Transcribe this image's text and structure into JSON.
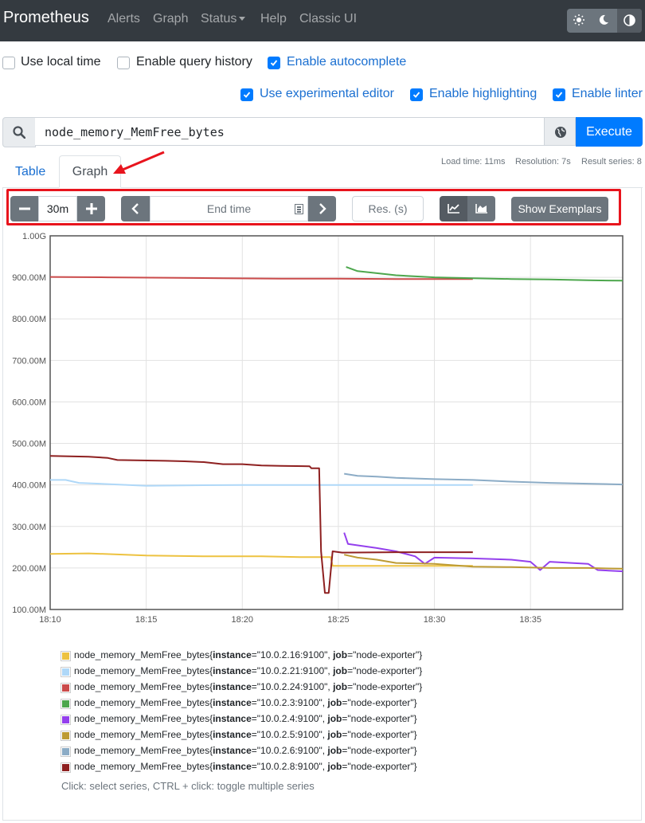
{
  "navbar": {
    "brand": "Prometheus",
    "links": [
      "Alerts",
      "Graph",
      "Status",
      "Help",
      "Classic UI"
    ],
    "theme_icons": [
      "sun-icon",
      "moon-icon",
      "contrast-icon"
    ]
  },
  "options_row1": [
    {
      "label": "Use local time",
      "checked": false
    },
    {
      "label": "Enable query history",
      "checked": false
    },
    {
      "label": "Enable autocomplete",
      "checked": true
    }
  ],
  "options_row2": [
    {
      "label": "Use experimental editor",
      "checked": true
    },
    {
      "label": "Enable highlighting",
      "checked": true
    },
    {
      "label": "Enable linter",
      "checked": true
    }
  ],
  "search": {
    "expression": "node_memory_MemFree_bytes",
    "execute_label": "Execute"
  },
  "tabs": {
    "table": "Table",
    "graph": "Graph"
  },
  "stats": {
    "load_time": "Load time: 11ms",
    "resolution": "Resolution: 7s",
    "result_series": "Result series: 8"
  },
  "controls": {
    "range": "30m",
    "end_time_placeholder": "End time",
    "resolution_placeholder": "Res. (s)",
    "show_exemplars": "Show Exemplars"
  },
  "chart_data": {
    "type": "line",
    "ylim": [
      100,
      1000
    ],
    "y_unit": "M",
    "yticks": [
      "1.00G",
      "900.00M",
      "800.00M",
      "700.00M",
      "600.00M",
      "500.00M",
      "400.00M",
      "300.00M",
      "200.00M",
      "100.00M"
    ],
    "xticks": [
      "18:10",
      "18:15",
      "18:20",
      "18:25",
      "18:30",
      "18:35"
    ],
    "xlim_minutes": [
      0,
      29.8
    ],
    "series": [
      {
        "metric": "node_memory_MemFree_bytes",
        "instance": "10.0.2.16:9100",
        "job": "node-exporter",
        "color": "#edc240",
        "points": [
          [
            0,
            234
          ],
          [
            2,
            235
          ],
          [
            5,
            230
          ],
          [
            8,
            228
          ],
          [
            11,
            228
          ],
          [
            13,
            226
          ],
          [
            14.6,
            226
          ],
          [
            14.7,
            205
          ],
          [
            20,
            205
          ],
          [
            22,
            205
          ]
        ]
      },
      {
        "metric": "node_memory_MemFree_bytes",
        "instance": "10.0.2.21:9100",
        "job": "node-exporter",
        "color": "#afd8f8",
        "points": [
          [
            0,
            412
          ],
          [
            0.8,
            412
          ],
          [
            1.5,
            405
          ],
          [
            3,
            402
          ],
          [
            5,
            398
          ],
          [
            7,
            399
          ],
          [
            10,
            400
          ],
          [
            14,
            400
          ],
          [
            18,
            400
          ],
          [
            21,
            400
          ],
          [
            22,
            400
          ]
        ]
      },
      {
        "metric": "node_memory_MemFree_bytes",
        "instance": "10.0.2.24:9100",
        "job": "node-exporter",
        "color": "#cb4b4b",
        "points": [
          [
            0,
            901
          ],
          [
            3,
            900
          ],
          [
            6,
            899
          ],
          [
            9,
            898
          ],
          [
            12,
            897
          ],
          [
            15,
            897
          ],
          [
            18,
            896
          ],
          [
            22,
            896
          ]
        ]
      },
      {
        "metric": "node_memory_MemFree_bytes",
        "instance": "10.0.2.3:9100",
        "job": "node-exporter",
        "color": "#4da74d",
        "points": [
          [
            15.4,
            925
          ],
          [
            16,
            915
          ],
          [
            17,
            910
          ],
          [
            18,
            905
          ],
          [
            20,
            900
          ],
          [
            22,
            898
          ],
          [
            24,
            896
          ],
          [
            26,
            895
          ],
          [
            28,
            893
          ],
          [
            29.8,
            892
          ]
        ]
      },
      {
        "metric": "node_memory_MemFree_bytes",
        "instance": "10.0.2.4:9100",
        "job": "node-exporter",
        "color": "#9440ed",
        "points": [
          [
            15.3,
            285
          ],
          [
            15.5,
            258
          ],
          [
            17,
            248
          ],
          [
            18,
            240
          ],
          [
            19,
            228
          ],
          [
            19.5,
            210
          ],
          [
            20,
            225
          ],
          [
            22,
            223
          ],
          [
            24,
            220
          ],
          [
            25,
            215
          ],
          [
            25.5,
            195
          ],
          [
            26,
            215
          ],
          [
            28,
            210
          ],
          [
            28.5,
            195
          ],
          [
            29.8,
            192
          ]
        ]
      },
      {
        "metric": "node_memory_MemFree_bytes",
        "instance": "10.0.2.5:9100",
        "job": "node-exporter",
        "color": "#bd9b33",
        "points": [
          [
            15.3,
            232
          ],
          [
            16,
            225
          ],
          [
            17,
            220
          ],
          [
            18,
            212
          ],
          [
            20,
            210
          ],
          [
            22,
            203
          ],
          [
            24,
            202
          ],
          [
            26,
            200
          ],
          [
            28,
            200
          ],
          [
            29.8,
            198
          ]
        ]
      },
      {
        "metric": "node_memory_MemFree_bytes",
        "instance": "10.0.2.6:9100",
        "job": "node-exporter",
        "color": "#8cacc6",
        "points": [
          [
            15.3,
            427
          ],
          [
            16,
            422
          ],
          [
            17,
            420
          ],
          [
            18,
            417
          ],
          [
            20,
            414
          ],
          [
            22,
            412
          ],
          [
            24,
            408
          ],
          [
            26,
            405
          ],
          [
            28,
            403
          ],
          [
            29.8,
            401
          ]
        ]
      },
      {
        "metric": "node_memory_MemFree_bytes",
        "instance": "10.0.2.8:9100",
        "job": "node-exporter",
        "color": "#8e2020",
        "points": [
          [
            0,
            470
          ],
          [
            2,
            468
          ],
          [
            3,
            465
          ],
          [
            3.5,
            460
          ],
          [
            6,
            458
          ],
          [
            7,
            457
          ],
          [
            8,
            455
          ],
          [
            9,
            450
          ],
          [
            10,
            450
          ],
          [
            11,
            447
          ],
          [
            12,
            446
          ],
          [
            13.5,
            445
          ],
          [
            13.6,
            440
          ],
          [
            14,
            440
          ],
          [
            14.1,
            240
          ],
          [
            14.3,
            140
          ],
          [
            14.5,
            140
          ],
          [
            14.7,
            240
          ],
          [
            15.2,
            237
          ],
          [
            18,
            238
          ],
          [
            22,
            238
          ]
        ]
      }
    ]
  },
  "legend_hint": "Click: select series, CTRL + click: toggle multiple series"
}
